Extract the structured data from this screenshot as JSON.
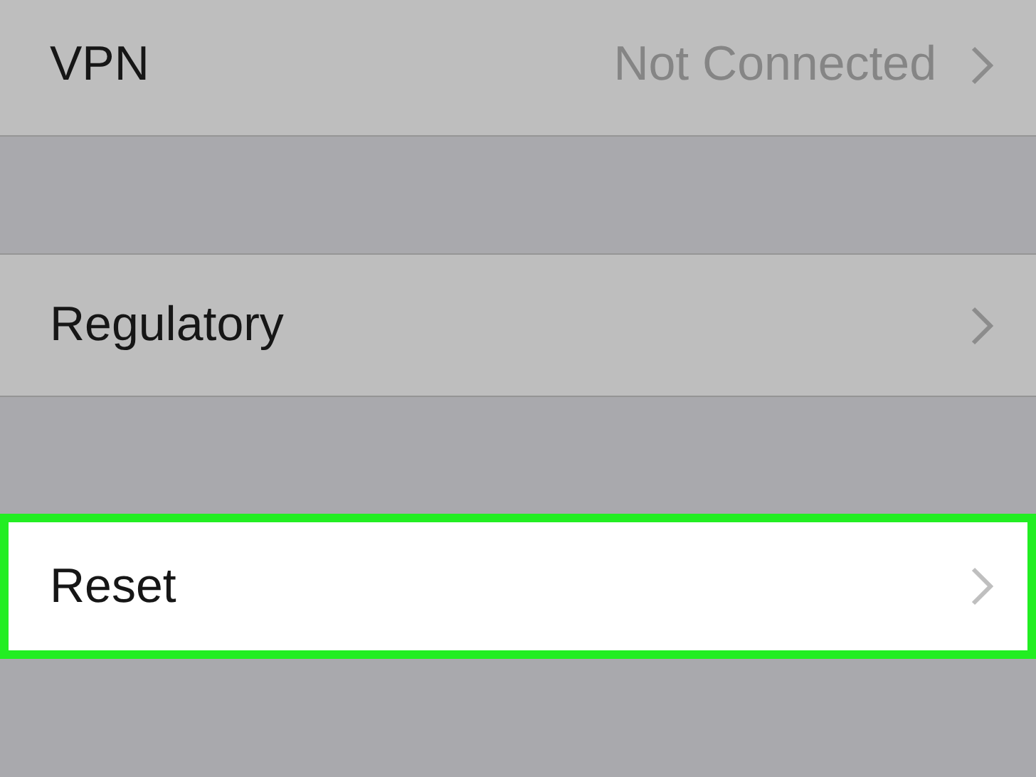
{
  "groups": [
    {
      "rows": [
        {
          "label": "VPN",
          "value": "Not Connected",
          "highlighted": false
        }
      ]
    },
    {
      "rows": [
        {
          "label": "Regulatory",
          "highlighted": false
        }
      ]
    },
    {
      "rows": [
        {
          "label": "Reset",
          "highlighted": true
        }
      ]
    }
  ]
}
